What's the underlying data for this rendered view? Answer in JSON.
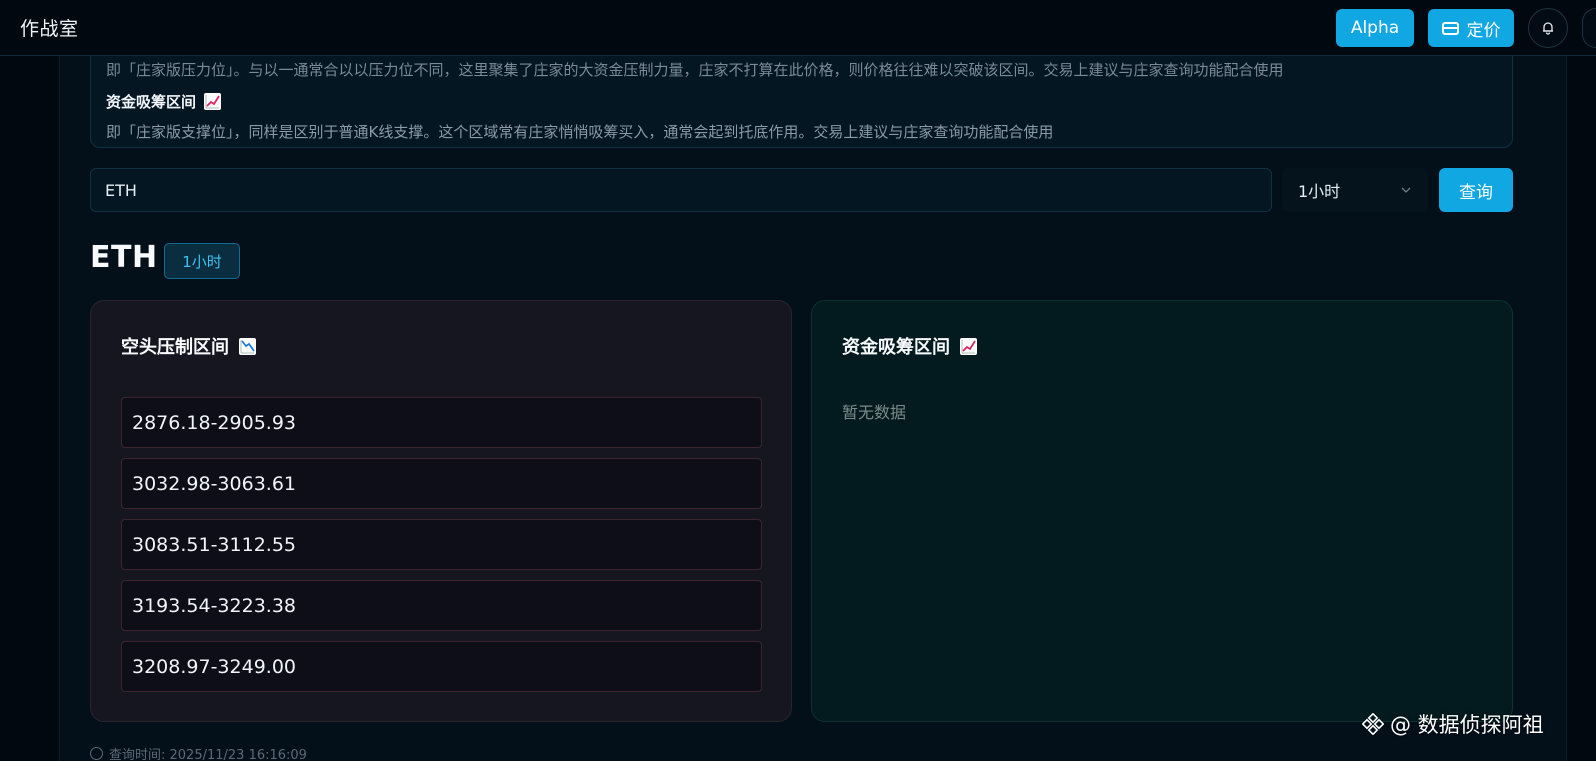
{
  "header": {
    "title": "作战室",
    "alpha_label": "Alpha",
    "pricing_label": "定价"
  },
  "info": {
    "clipped_text": "即「庄家版压力位」。与以一通常合以以压力位不同，这里聚集了庄家的大资金压制力量，庄家不打算在此价格，则价格往往难以突破该区间。交易上建议与庄家查询功能配合使用",
    "accumulation_heading": "资金吸筹区间",
    "accumulation_text": "即「庄家版支撑位」，同样是区别于普通K线支撑。这个区域常有庄家悄悄吸筹买入，通常会起到托底作用。交易上建议与庄家查询功能配合使用"
  },
  "query": {
    "symbol_value": "ETH",
    "interval_value": "1小时",
    "submit_label": "查询"
  },
  "result": {
    "symbol": "ETH",
    "interval_tag": "1小时"
  },
  "short_panel": {
    "title": "空头压制区间",
    "ranges": [
      "2876.18-2905.93",
      "3032.98-3063.61",
      "3083.51-3112.55",
      "3193.54-3223.38",
      "3208.97-3249.00"
    ]
  },
  "long_panel": {
    "title": "资金吸筹区间",
    "empty_text": "暂无数据"
  },
  "footer": {
    "query_time": "查询时间: 2025/11/23 16:16:09"
  },
  "watermark": {
    "text": "@ 数据侦探阿祖"
  },
  "colors": {
    "accent": "#10a7e3",
    "short_border": "#3b2630",
    "long_bg": "#031b1e"
  }
}
